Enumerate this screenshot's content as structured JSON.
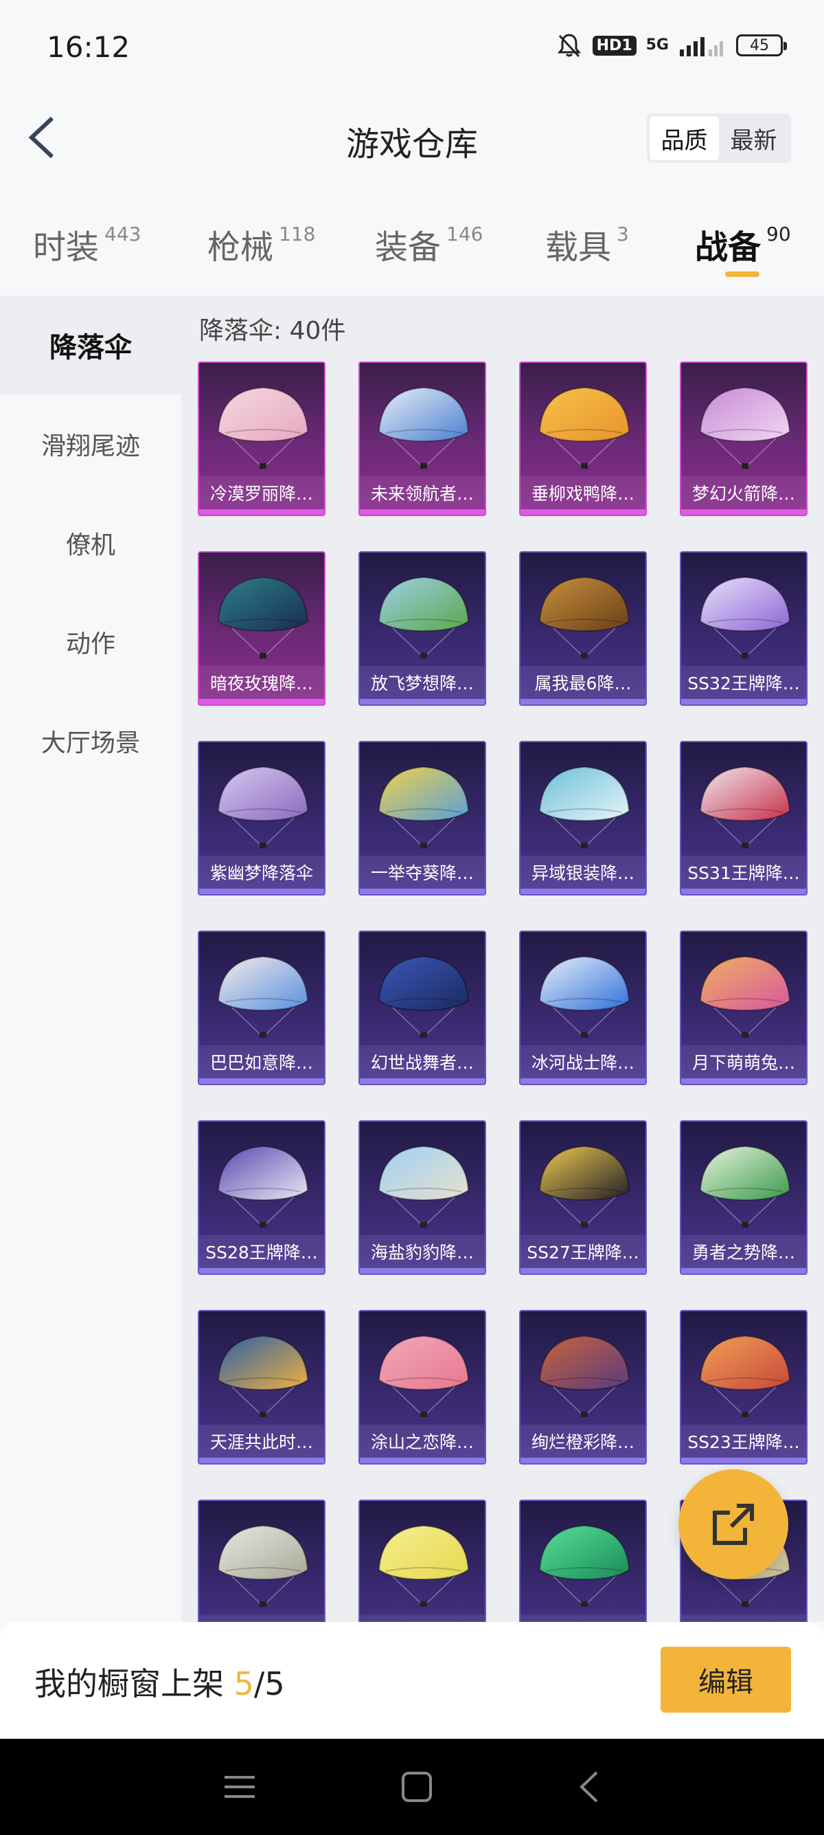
{
  "status_bar": {
    "time": "16:12",
    "hd_label": "HD1",
    "network_label": "5G",
    "battery": "45"
  },
  "header": {
    "title": "游戏仓库",
    "sort_options": [
      "品质",
      "最新"
    ],
    "active_sort": "品质"
  },
  "tabs": [
    {
      "label": "时装",
      "count": "443"
    },
    {
      "label": "枪械",
      "count": "118"
    },
    {
      "label": "装备",
      "count": "146"
    },
    {
      "label": "载具",
      "count": "3"
    },
    {
      "label": "战备",
      "count": "90",
      "active": true
    }
  ],
  "sidebar": {
    "items": [
      "降落伞",
      "滑翔尾迹",
      "僚机",
      "动作",
      "大厅场景"
    ],
    "active": "降落伞"
  },
  "section": {
    "title": "降落伞: 40件"
  },
  "items": [
    {
      "name": "冷漠罗丽降…",
      "rarity": "legend",
      "colors": [
        "#f5d7e0",
        "#e7a9c0"
      ]
    },
    {
      "name": "未来领航者…",
      "rarity": "legend",
      "colors": [
        "#e8eef8",
        "#4a7fd0"
      ]
    },
    {
      "name": "垂柳戏鸭降…",
      "rarity": "legend",
      "colors": [
        "#f6c24a",
        "#e8932c"
      ]
    },
    {
      "name": "梦幻火箭降…",
      "rarity": "legend",
      "colors": [
        "#c88ad8",
        "#f0d7f0"
      ]
    },
    {
      "name": "暗夜玫瑰降…",
      "rarity": "legend",
      "colors": [
        "#2e7f8c",
        "#1b2d50"
      ]
    },
    {
      "name": "放飞梦想降…",
      "rarity": "epic",
      "colors": [
        "#9ed0e8",
        "#5aa84a"
      ]
    },
    {
      "name": "属我最6降…",
      "rarity": "epic",
      "colors": [
        "#c8913a",
        "#6a3e1a"
      ]
    },
    {
      "name": "SS32王牌降…",
      "rarity": "epic",
      "colors": [
        "#e8e0f8",
        "#8e66d8"
      ]
    },
    {
      "name": "紫幽梦降落伞",
      "rarity": "epic",
      "colors": [
        "#d8c8f0",
        "#8a6ac0"
      ]
    },
    {
      "name": "一举夺葵降…",
      "rarity": "epic",
      "colors": [
        "#f0d24a",
        "#5aa0d8"
      ]
    },
    {
      "name": "异域银装降…",
      "rarity": "epic",
      "colors": [
        "#6ac0d8",
        "#e8f4f8"
      ]
    },
    {
      "name": "SS31王牌降…",
      "rarity": "epic",
      "colors": [
        "#f0e8f0",
        "#c83048"
      ]
    },
    {
      "name": "巴巴如意降…",
      "rarity": "epic",
      "colors": [
        "#f4ece8",
        "#5a90e0"
      ]
    },
    {
      "name": "幻世战舞者…",
      "rarity": "epic",
      "colors": [
        "#3a58b8",
        "#1c2a60"
      ]
    },
    {
      "name": "冰河战士降…",
      "rarity": "epic",
      "colors": [
        "#e8f0fa",
        "#3070d8"
      ]
    },
    {
      "name": "月下萌萌兔…",
      "rarity": "epic",
      "colors": [
        "#f0b060",
        "#d858a0"
      ]
    },
    {
      "name": "SS28王牌降…",
      "rarity": "epic",
      "colors": [
        "#5a48b0",
        "#e8e8f4"
      ]
    },
    {
      "name": "海盐豹豹降…",
      "rarity": "epic",
      "colors": [
        "#9ed0f0",
        "#e8e0d0"
      ]
    },
    {
      "name": "SS27王牌降…",
      "rarity": "epic",
      "colors": [
        "#f0c850",
        "#202028"
      ]
    },
    {
      "name": "勇者之势降…",
      "rarity": "epic",
      "colors": [
        "#e8f4e0",
        "#3a9a48"
      ]
    },
    {
      "name": "天涯共此时…",
      "rarity": "epic",
      "colors": [
        "#2a60a8",
        "#f0b040"
      ]
    },
    {
      "name": "涂山之恋降…",
      "rarity": "epic",
      "colors": [
        "#f0a8b8",
        "#e87890"
      ]
    },
    {
      "name": "绚烂橙彩降…",
      "rarity": "epic",
      "colors": [
        "#c8643a",
        "#5a3a80"
      ]
    },
    {
      "name": "SS23王牌降…",
      "rarity": "epic",
      "colors": [
        "#f0a058",
        "#c84838"
      ]
    },
    {
      "name": "",
      "rarity": "epic",
      "colors": [
        "#e8e8e0",
        "#a8a898"
      ]
    },
    {
      "name": "",
      "rarity": "epic",
      "colors": [
        "#f4ee90",
        "#e8d850"
      ]
    },
    {
      "name": "",
      "rarity": "epic",
      "colors": [
        "#58e098",
        "#1a8a58"
      ]
    },
    {
      "name": "",
      "rarity": "epic",
      "colors": [
        "#e8e0c8",
        "#c8b890"
      ]
    }
  ],
  "showcase": {
    "label": "我的橱窗上架 ",
    "count": "5",
    "total": "/5",
    "edit_label": "编辑"
  },
  "colors": {
    "accent": "#f2b53a",
    "legend_border": "#d34ad6",
    "epic_border": "#6b55c8"
  }
}
